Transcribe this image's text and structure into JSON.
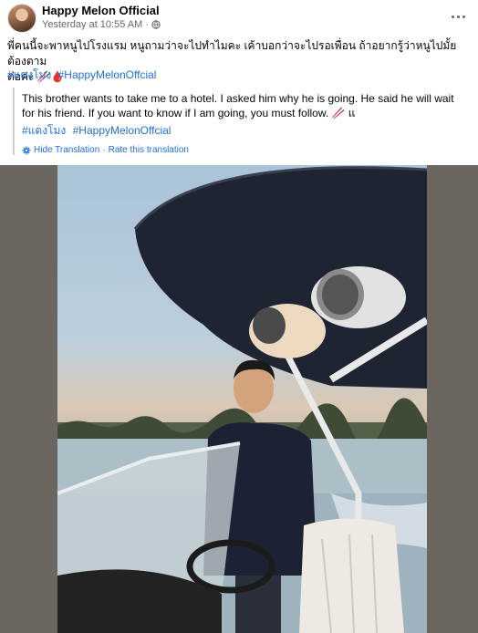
{
  "post": {
    "author": "Happy Melon Official",
    "timestamp": "Yesterday at 10:55 AM",
    "privacy_separator": "·",
    "more_icon": "more-horizontal-icon",
    "text_line1": "พี่คนนี้จะพาหนูไปโรงแรม หนูถามว่าจะไปทำไมคะ เค้าบอกว่าจะไปรอเพื่อน ถ้าอยากรู้ว่าหนูไปมั้ย ต้องตาม",
    "text_line2": "ต่อค่ะ 🥢🩸",
    "hashtags": [
      "#แตงโมง",
      "#HappyMelonOffcial"
    ]
  },
  "translation": {
    "text": "This brother wants to take me to a hotel. I asked him why he is going. He said he will wait for his friend. If you want to know if I am going, you must follow. 🥢 แ",
    "hashtags": [
      "#แตงโมง",
      "#HappyMelonOffcial"
    ],
    "hide_label": "Hide Translation",
    "separator": "·",
    "rate_label": "Rate this translation"
  },
  "colors": {
    "link": "#216fdb",
    "meta": "#65676b"
  }
}
